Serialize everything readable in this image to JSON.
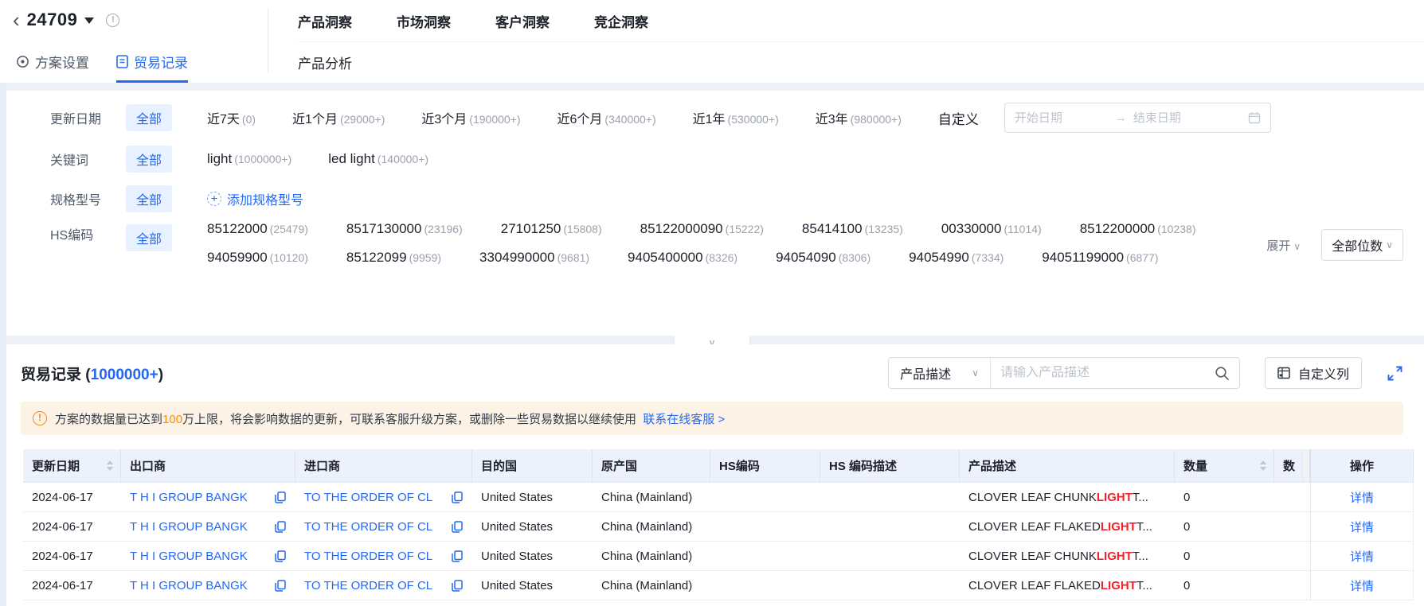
{
  "colors": {
    "accent": "#2468f2",
    "keyword_red": "#f5222d",
    "warn_orange": "#ff8a00",
    "banner_bg": "#fcf3e6",
    "chip_bg": "#e8f1ff",
    "table_header_bg": "#edf1fa"
  },
  "icons": {
    "back": "‹",
    "info": "!",
    "warn": "!",
    "plus": "+",
    "chevron_down": "∨",
    "arrow_right": "→"
  },
  "header": {
    "plan_id": "24709",
    "tabs": [
      {
        "label": "方案设置"
      },
      {
        "label": "贸易记录"
      }
    ],
    "nav": [
      {
        "label": "产品洞察"
      },
      {
        "label": "市场洞察"
      },
      {
        "label": "客户洞察"
      },
      {
        "label": "竞企洞察"
      }
    ],
    "subnav": [
      {
        "label": "产品分析"
      }
    ]
  },
  "filters": {
    "update_date": {
      "label": "更新日期",
      "all": "全部",
      "options": [
        {
          "name": "近7天",
          "count": "(0)"
        },
        {
          "name": "近1个月",
          "count": "(29000+)"
        },
        {
          "name": "近3个月",
          "count": "(190000+)"
        },
        {
          "name": "近6个月",
          "count": "(340000+)"
        },
        {
          "name": "近1年",
          "count": "(530000+)"
        },
        {
          "name": "近3年",
          "count": "(980000+)"
        }
      ],
      "custom_label": "自定义",
      "start_placeholder": "开始日期",
      "end_placeholder": "结束日期"
    },
    "keyword": {
      "label": "关键词",
      "all": "全部",
      "options": [
        {
          "name": "light",
          "count": "(1000000+)"
        },
        {
          "name": "led light",
          "count": "(140000+)"
        }
      ]
    },
    "spec": {
      "label": "规格型号",
      "all": "全部",
      "add_label": "添加规格型号"
    },
    "hs": {
      "label": "HS编码",
      "all": "全部",
      "line1": [
        {
          "code": "85122000",
          "count": "(25479)"
        },
        {
          "code": "8517130000",
          "count": "(23196)"
        },
        {
          "code": "27101250",
          "count": "(15808)"
        },
        {
          "code": "85122000090",
          "count": "(15222)"
        },
        {
          "code": "85414100",
          "count": "(13235)"
        },
        {
          "code": "00330000",
          "count": "(11014)"
        },
        {
          "code": "8512200000",
          "count": "(10238)"
        }
      ],
      "line2": [
        {
          "code": "94059900",
          "count": "(10120)"
        },
        {
          "code": "85122099",
          "count": "(9959)"
        },
        {
          "code": "3304990000",
          "count": "(9681)"
        },
        {
          "code": "9405400000",
          "count": "(8326)"
        },
        {
          "code": "94054090",
          "count": "(8306)"
        },
        {
          "code": "94054990",
          "count": "(7334)"
        },
        {
          "code": "94051199000",
          "count": "(6877)"
        }
      ],
      "expand_label": "展开",
      "digits_label": "全部位数"
    }
  },
  "records": {
    "title": {
      "label": "贸易记录",
      "open": "(",
      "count": "1000000+",
      "close": ")"
    },
    "search_field": "产品描述",
    "search_placeholder": "请输入产品描述",
    "custom_columns_label": "自定义列",
    "banner": {
      "pre": "方案的数据量已达到",
      "num": "100",
      "post": "万上限，将会影响数据的更新，可联系客服升级方案，或删除一些贸易数据以继续使用",
      "link": "联系在线客服 >"
    }
  },
  "table": {
    "headers": [
      "更新日期",
      "出口商",
      "进口商",
      "目的国",
      "原产国",
      "HS编码",
      "HS 编码描述",
      "产品描述",
      "数量",
      "数",
      "操作"
    ],
    "action_label": "详情",
    "rows": [
      {
        "date": "2024-06-17",
        "exporter": "T H I GROUP BANGK",
        "importer": "TO THE ORDER OF CL",
        "dest": "United States",
        "origin": "China (Mainland)",
        "hs_code": "",
        "hs_desc": "",
        "product": {
          "pre": "CLOVER LEAF CHUNK ",
          "hl": "LIGHT",
          "post": " T..."
        },
        "qty": "0",
        "extra": ""
      },
      {
        "date": "2024-06-17",
        "exporter": "T H I GROUP BANGK",
        "importer": "TO THE ORDER OF CL",
        "dest": "United States",
        "origin": "China (Mainland)",
        "hs_code": "",
        "hs_desc": "",
        "product": {
          "pre": "CLOVER LEAF FLAKED ",
          "hl": "LIGHT",
          "post": " T..."
        },
        "qty": "0",
        "extra": ""
      },
      {
        "date": "2024-06-17",
        "exporter": "T H I GROUP BANGK",
        "importer": "TO THE ORDER OF CL",
        "dest": "United States",
        "origin": "China (Mainland)",
        "hs_code": "",
        "hs_desc": "",
        "product": {
          "pre": "CLOVER LEAF CHUNK ",
          "hl": "LIGHT",
          "post": " T..."
        },
        "qty": "0",
        "extra": ""
      },
      {
        "date": "2024-06-17",
        "exporter": "T H I GROUP BANGK",
        "importer": "TO THE ORDER OF CL",
        "dest": "United States",
        "origin": "China (Mainland)",
        "hs_code": "",
        "hs_desc": "",
        "product": {
          "pre": "CLOVER LEAF FLAKED ",
          "hl": "LIGHT",
          "post": " T..."
        },
        "qty": "0",
        "extra": ""
      }
    ]
  }
}
